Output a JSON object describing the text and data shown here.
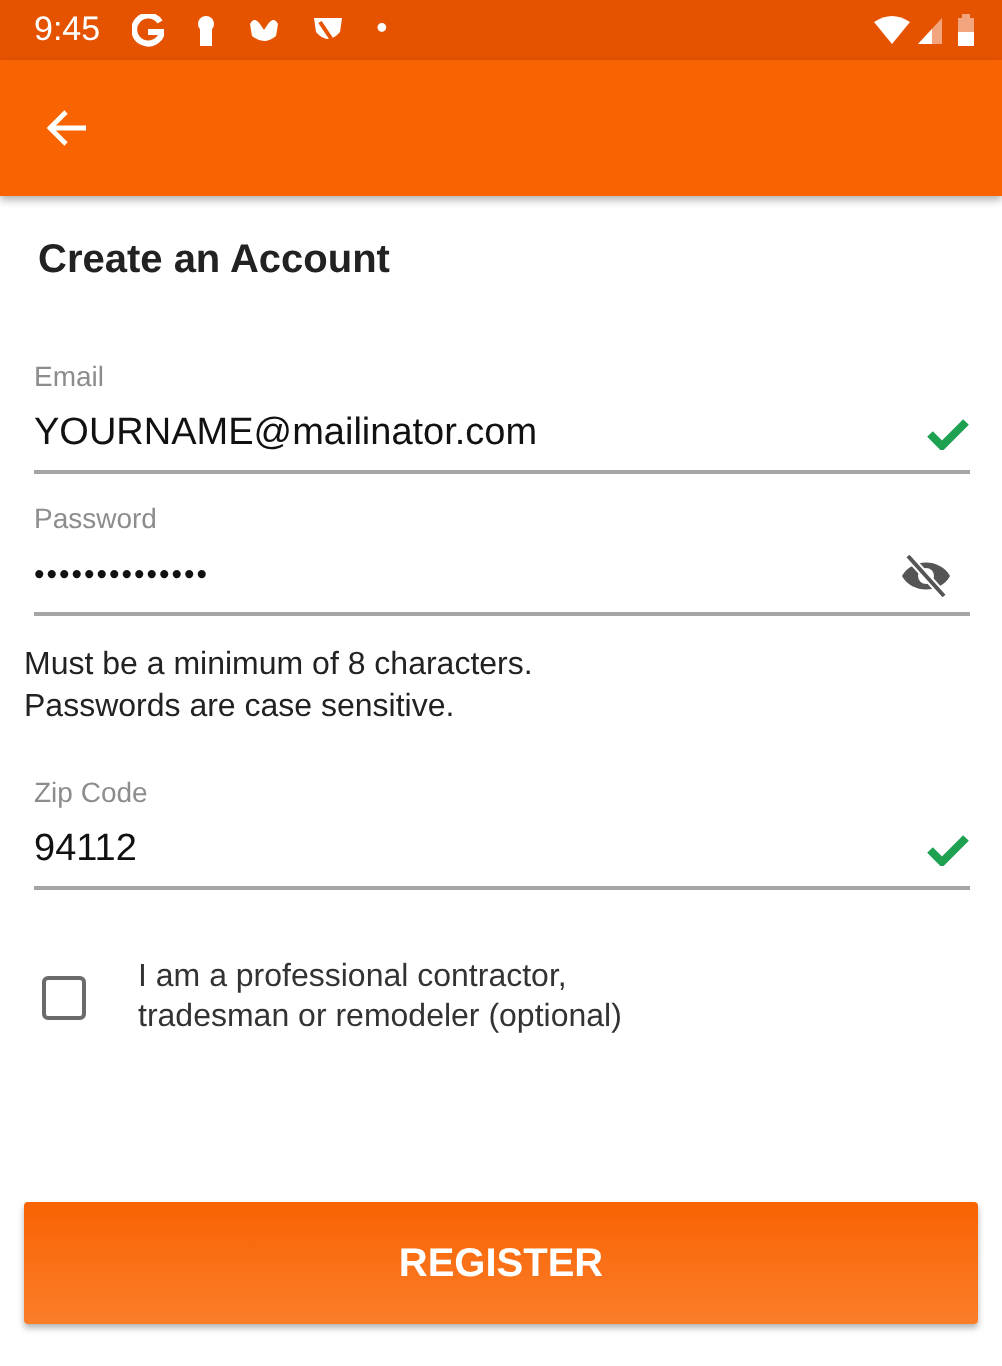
{
  "status_bar": {
    "time": "9:45",
    "dot": "•"
  },
  "title": "Create an Account",
  "fields": [
    {
      "kind": "email",
      "label": "Email",
      "value": "YOURNAME@mailinator.com",
      "valid": true
    },
    {
      "kind": "password",
      "label": "Password",
      "value": "••••••••••••••",
      "masked": true
    },
    {
      "kind": "text",
      "label": "Zip Code",
      "value": "94112",
      "valid": true
    }
  ],
  "password_hint": [
    "Must be a minimum of 8 characters.",
    "Passwords are case sensitive."
  ],
  "contractor": {
    "label": "I am a professional contractor, tradesman or remodeler (optional)",
    "checked": false
  },
  "button": "REGISTER"
}
